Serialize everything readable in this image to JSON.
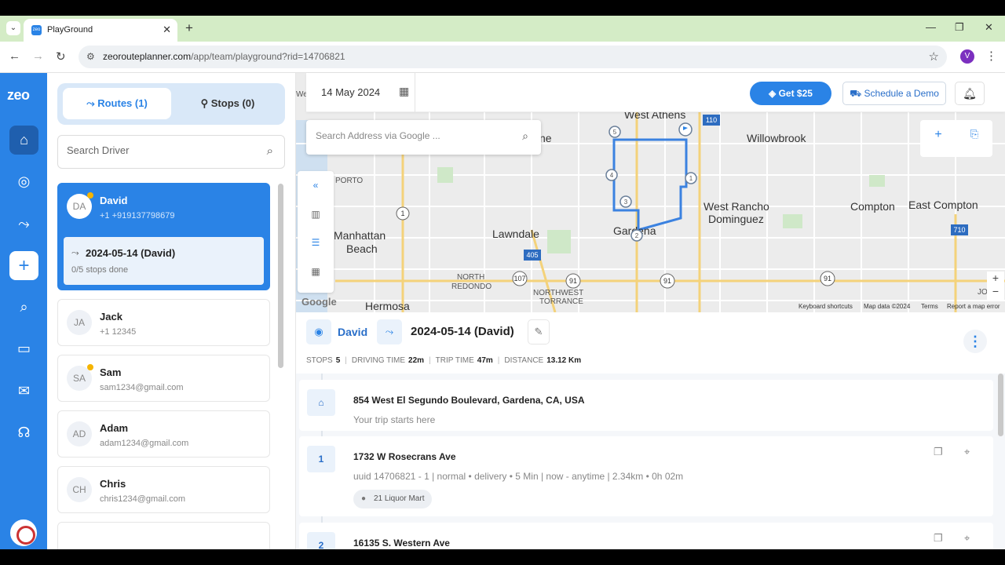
{
  "browser": {
    "tab_title": "PlayGround",
    "url_domain": "zeorouteplanner.com",
    "url_path": "/app/team/playground?rid=14706821",
    "profile_initial": "V"
  },
  "rail": {
    "logo": "zeo"
  },
  "tabs": {
    "routes": "Routes (1)",
    "stops": "Stops (0)"
  },
  "driver_search": {
    "placeholder": "Search Driver"
  },
  "drivers": [
    {
      "initials": "DA",
      "name": "David",
      "sub": "+1 +919137798679",
      "route": "2024-05-14 (David)",
      "progress": "0/5 stops done"
    },
    {
      "initials": "JA",
      "name": "Jack",
      "sub": "+1 12345"
    },
    {
      "initials": "SA",
      "name": "Sam",
      "sub": "sam1234@gmail.com"
    },
    {
      "initials": "AD",
      "name": "Adam",
      "sub": "adam1234@gmail.com"
    },
    {
      "initials": "CH",
      "name": "Chris",
      "sub": "chris1234@gmail.com"
    }
  ],
  "topbar": {
    "date": "14 May 2024",
    "get_button": "Get $25",
    "demo_button": "Schedule a Demo"
  },
  "address_search": {
    "placeholder": "Search Address via Google ..."
  },
  "map": {
    "labels": [
      "West Athens",
      "Willowbrook",
      "West Rancho",
      "Dominguez",
      "Compton",
      "East Compton",
      "Lawndale",
      "Manhattan",
      "Beach",
      "Gardena",
      "NORTH",
      "REDONDO",
      "NORTHWEST",
      "TORRANCE",
      "Hermosa",
      "JORD",
      "PORTO",
      "ne",
      "We"
    ],
    "shields": [
      "110",
      "1",
      "405",
      "107",
      "91",
      "91",
      "91",
      "710"
    ],
    "google": "Google",
    "attr_shortcuts": "Keyboard shortcuts",
    "attr_data": "Map data ©2024",
    "attr_terms": "Terms",
    "attr_report": "Report a map error",
    "markers": [
      "5",
      "4",
      "3",
      "2",
      "1"
    ]
  },
  "route_header": {
    "driver": "David",
    "route": "2024-05-14 (David)"
  },
  "stats": {
    "stops_label": "STOPS",
    "stops_value": "5",
    "driving_label": "DRIVING TIME",
    "driving_value": "22m",
    "trip_label": "TRIP TIME",
    "trip_value": "47m",
    "distance_label": "DISTANCE",
    "distance_value": "13.12 Km"
  },
  "stops": [
    {
      "badge": "home",
      "title": "854 West El Segundo Boulevard, Gardena, CA, USA",
      "sub": "Your trip starts here"
    },
    {
      "badge": "1",
      "title": "1732 W Rosecrans Ave",
      "sub": "uuid 14706821 - 1   |   normal • delivery • 5 Min   |   now - anytime   |   2.34km • 0h 02m",
      "chip": "21 Liquor Mart"
    },
    {
      "badge": "2",
      "title": "16135 S. Western Ave"
    }
  ]
}
